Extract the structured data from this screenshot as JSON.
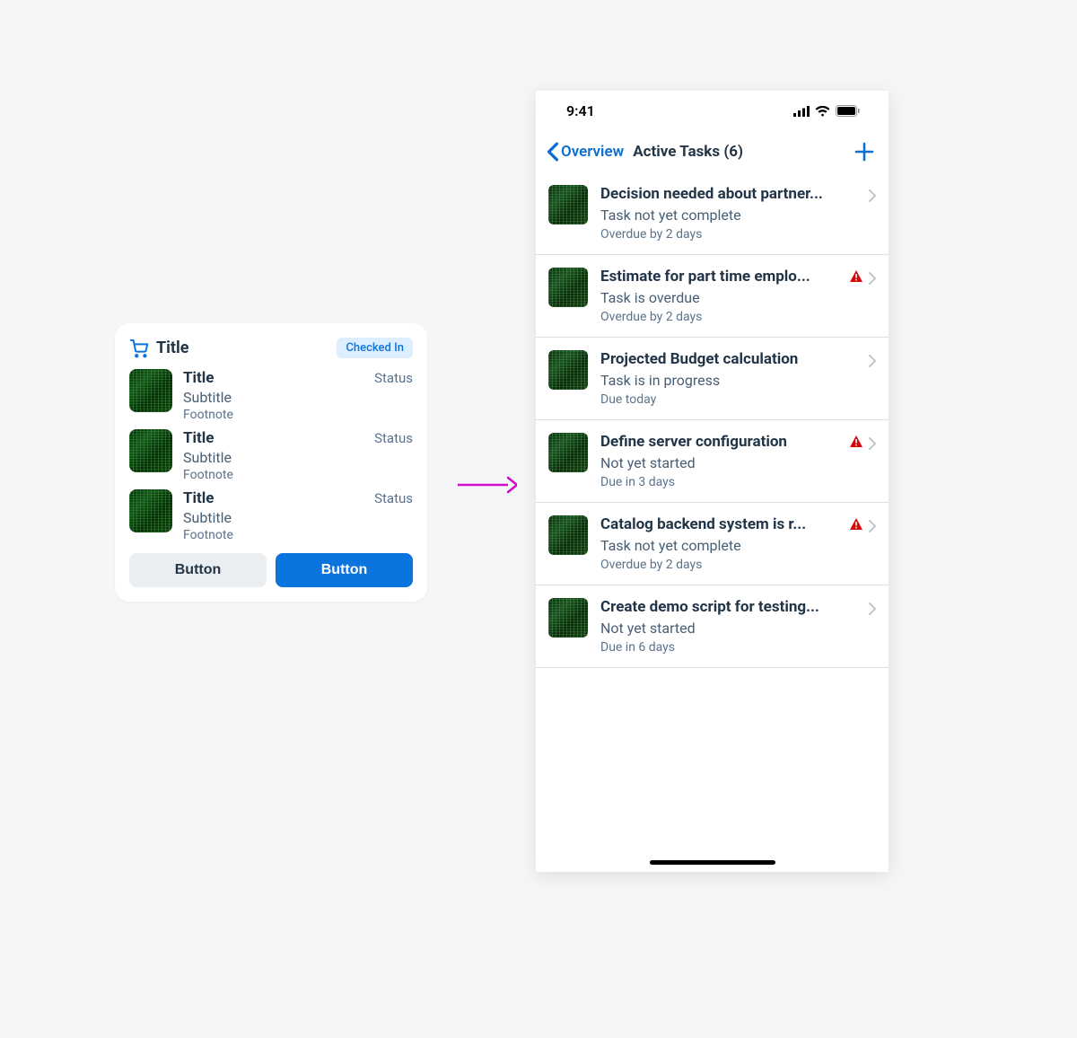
{
  "card": {
    "header_title": "Title",
    "badge": "Checked In",
    "rows": [
      {
        "title": "Title",
        "status": "Status",
        "subtitle": "Subtitle",
        "footnote": "Footnote"
      },
      {
        "title": "Title",
        "status": "Status",
        "subtitle": "Subtitle",
        "footnote": "Footnote"
      },
      {
        "title": "Title",
        "status": "Status",
        "subtitle": "Subtitle",
        "footnote": "Footnote"
      }
    ],
    "btn_secondary": "Button",
    "btn_primary": "Button"
  },
  "phone": {
    "time": "9:41",
    "back_label": "Overview",
    "title": "Active Tasks (6)",
    "tasks": [
      {
        "title": "Decision needed about partner...",
        "status": "Task not yet complete",
        "due": "Overdue by 2 days",
        "warn": false
      },
      {
        "title": "Estimate for part time emplo...",
        "status": "Task is overdue",
        "due": "Overdue by 2 days",
        "warn": true
      },
      {
        "title": "Projected Budget calculation",
        "status": "Task is in progress",
        "due": "Due today",
        "warn": false
      },
      {
        "title": "Define server configuration",
        "status": "Not yet started",
        "due": "Due in 3 days",
        "warn": true
      },
      {
        "title": "Catalog backend system is r...",
        "status": "Task not yet complete",
        "due": "Overdue by 2 days",
        "warn": true
      },
      {
        "title": "Create demo script for testing...",
        "status": "Not yet started",
        "due": "Due in 6 days",
        "warn": false
      }
    ]
  }
}
